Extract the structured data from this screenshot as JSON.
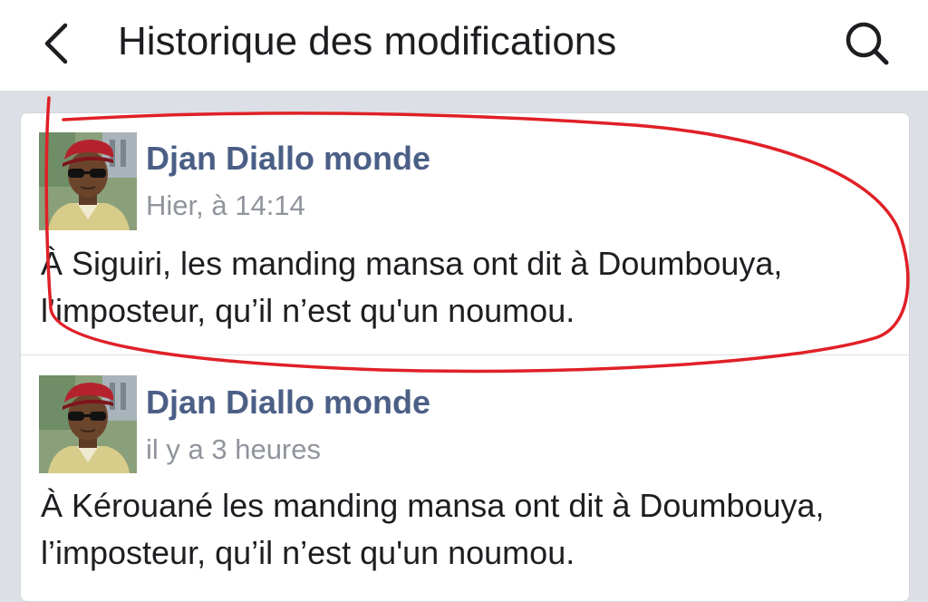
{
  "header": {
    "title": "Historique des modifications",
    "back_icon": "chevron-left-icon",
    "search_icon": "search-icon"
  },
  "entries": [
    {
      "author": "Djan Diallo monde",
      "time": "Hier, à 14:14",
      "text": "À Siguiri, les manding mansa ont dit à Doumbouya, l’imposteur, qu’il n’est qu'un noumou."
    },
    {
      "author": "Djan Diallo monde",
      "time": "il y a 3 heures",
      "text": "À Kérouané les manding mansa ont dit à Doumbouya, l’imposteur, qu’il n’est qu'un noumou."
    }
  ],
  "colors": {
    "author_link": "#4b5f86",
    "timestamp": "#90949c",
    "annotation_red": "#e02027",
    "beret": "#b5212c"
  }
}
